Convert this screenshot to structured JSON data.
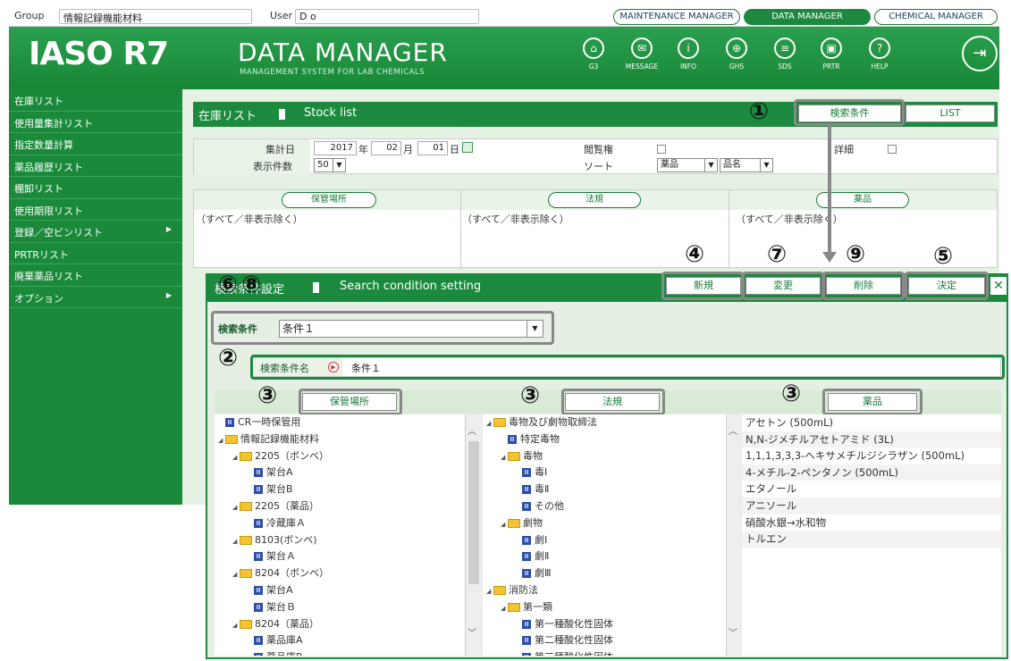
{
  "topbar": {
    "group_label": "Group",
    "group_value": "情報記録機能材料",
    "user_label": "User",
    "user_value": "D o",
    "managers": [
      {
        "label": "MAINTENANCE MANAGER"
      },
      {
        "label": "DATA MANAGER"
      },
      {
        "label": "CHEMICAL MANAGER"
      }
    ]
  },
  "header": {
    "logo": "IASO R7",
    "title": "DATA MANAGER",
    "subtitle": "MANAGEMENT SYSTEM FOR LAB CHEMICALS",
    "icons": [
      {
        "label": "G3",
        "icon": "g3-icon",
        "glyph": "⌂"
      },
      {
        "label": "MESSAGE",
        "icon": "message-icon",
        "glyph": "✉"
      },
      {
        "label": "INFO",
        "icon": "info-icon",
        "glyph": "i"
      },
      {
        "label": "GHS",
        "icon": "globe-icon",
        "glyph": "⊕"
      },
      {
        "label": "SDS",
        "icon": "document-icon",
        "glyph": "≡"
      },
      {
        "label": "PRTR",
        "icon": "prtr-icon",
        "glyph": "▣"
      },
      {
        "label": "HELP",
        "icon": "help-icon",
        "glyph": "?"
      }
    ],
    "exit_glyph": "⇥"
  },
  "sidebar": {
    "items": [
      {
        "label": "在庫リスト"
      },
      {
        "label": "使用量集計リスト"
      },
      {
        "label": "指定数量計算"
      },
      {
        "label": "薬品履歴リスト"
      },
      {
        "label": "棚卸リスト"
      },
      {
        "label": "使用期限リスト"
      },
      {
        "label": "登録／空ビンリスト",
        "arrow": "▶"
      },
      {
        "label": "PRTRリスト"
      },
      {
        "label": "廃棄薬品リスト"
      },
      {
        "label": "オプション",
        "arrow": "▶"
      }
    ]
  },
  "main": {
    "title": "在庫リスト",
    "title_en": "Stock list",
    "search_btn": "検索条件",
    "list_btn": "LIST",
    "row1": {
      "date_label": "集計日",
      "year": "2017",
      "year_unit": "年",
      "month": "02",
      "month_unit": "月",
      "day": "01",
      "day_unit": "日",
      "view_label": "閲覧権",
      "detail_label": "詳細"
    },
    "row2": {
      "count_label": "表示件数",
      "count": "50",
      "sort_label": "ソート",
      "sort1": "薬品",
      "sort2": "品名"
    },
    "cols": [
      {
        "label": "保管場所",
        "value": "（すべて／非表示除く）"
      },
      {
        "label": "法規",
        "value": "（すべて／非表示除く）"
      },
      {
        "label": "薬品",
        "value": "（すべて／非表示除く）"
      }
    ]
  },
  "dialog": {
    "title": "検索条件設定",
    "title_en": "Search condition setting",
    "buttons": {
      "new": "新規",
      "change": "変更",
      "delete": "削除",
      "decide": "決定"
    },
    "close": "✕",
    "cond_label": "検索条件",
    "cond_value": "条件１",
    "name_label": "検索条件名",
    "name_value": "条件１",
    "col_headers": {
      "storage": "保管場所",
      "law": "法規",
      "drug": "薬品"
    },
    "storage_tree": [
      {
        "type": "leaf",
        "depth": 0,
        "label": "CR一時保管用"
      },
      {
        "type": "folder",
        "depth": 0,
        "label": "情報記録機能材料"
      },
      {
        "type": "folder",
        "depth": 1,
        "label": "2205（ボンベ）"
      },
      {
        "type": "leaf",
        "depth": 2,
        "label": "架台A"
      },
      {
        "type": "leaf",
        "depth": 2,
        "label": "架台B"
      },
      {
        "type": "folder",
        "depth": 1,
        "label": "2205（薬品）"
      },
      {
        "type": "leaf",
        "depth": 2,
        "label": "冷蔵庫Ａ"
      },
      {
        "type": "folder",
        "depth": 1,
        "label": "8103(ボンベ)"
      },
      {
        "type": "leaf",
        "depth": 2,
        "label": "架台Ａ"
      },
      {
        "type": "folder",
        "depth": 1,
        "label": "8204（ボンベ）"
      },
      {
        "type": "leaf",
        "depth": 2,
        "label": "架台A"
      },
      {
        "type": "leaf",
        "depth": 2,
        "label": "架台Ｂ"
      },
      {
        "type": "folder",
        "depth": 1,
        "label": "8204（薬品）"
      },
      {
        "type": "leaf",
        "depth": 2,
        "label": "薬品庫A"
      },
      {
        "type": "leaf",
        "depth": 2,
        "label": "薬品庫B"
      }
    ],
    "law_tree": [
      {
        "type": "folder",
        "depth": 0,
        "label": "毒物及び劇物取締法"
      },
      {
        "type": "leaf",
        "depth": 1,
        "label": "特定毒物"
      },
      {
        "type": "folder",
        "depth": 1,
        "label": "毒物"
      },
      {
        "type": "leaf",
        "depth": 2,
        "label": "毒Ⅰ"
      },
      {
        "type": "leaf",
        "depth": 2,
        "label": "毒Ⅱ"
      },
      {
        "type": "leaf",
        "depth": 2,
        "label": "その他"
      },
      {
        "type": "folder",
        "depth": 1,
        "label": "劇物"
      },
      {
        "type": "leaf",
        "depth": 2,
        "label": "劇Ⅰ"
      },
      {
        "type": "leaf",
        "depth": 2,
        "label": "劇Ⅱ"
      },
      {
        "type": "leaf",
        "depth": 2,
        "label": "劇Ⅲ"
      },
      {
        "type": "folder",
        "depth": 0,
        "label": "消防法"
      },
      {
        "type": "folder",
        "depth": 1,
        "label": "第一類"
      },
      {
        "type": "leaf",
        "depth": 2,
        "label": "第一種酸化性固体"
      },
      {
        "type": "leaf",
        "depth": 2,
        "label": "第二種酸化性固体"
      },
      {
        "type": "leaf",
        "depth": 2,
        "label": "第三種酸化性固体"
      }
    ],
    "drugs": [
      "アセトン (500mL)",
      "N,N-ジメチルアセトアミド (3L)",
      "1,1,1,3,3,3-ヘキサメチルジシラザン (500mL)",
      "4-メチル-2-ペンタノン (500mL)",
      "エタノール",
      "アニソール",
      "硝酸水銀→水和物",
      "トルエン"
    ]
  },
  "callouts": {
    "n1": "①",
    "n2": "②",
    "n3": "③",
    "n4": "④",
    "n5": "⑤",
    "n6": "⑥",
    "n7": "⑦",
    "n8": "⑧",
    "n9": "⑨"
  },
  "colors": {
    "green": "#1b8a3e",
    "highlight": "#888888"
  }
}
